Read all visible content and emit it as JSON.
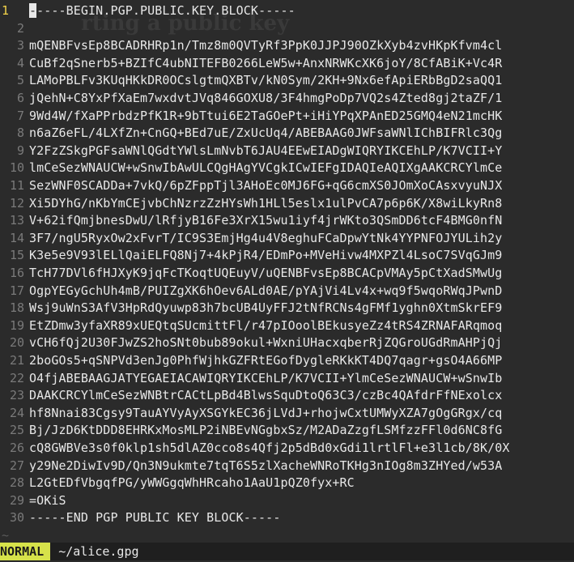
{
  "editor": {
    "lines": [
      "-----BEGIN.PGP.PUBLIC.KEY.BLOCK-----",
      "",
      "mQENBFvsEp8BCADRHRp1n/Tmz8m0QVTyRf3PpK0JJPJ90OZkXyb4zvHKpKfvm4cl",
      "CuBf2qSnerb5+BZIfC4ubNITEFB0266LeW5w+AnxNRWKcXK6joY/8CfABiK+Vc4R",
      "LAMoPBLFv3KUqHKkDR0OCslgtmQXBTv/kN0Sym/2KH+9Nx6efApiERbBgD2saQQ1",
      "jQehN+C8YxPfXaEm7wxdvtJVq846GOXU8/3F4hmgPoDp7VQ2s4Zted8gj2taZF/1",
      "9Wd4W/fXaPPrbdzPfK1R+9bTtui6E2TaGOePt+iHiYPqXPAnED25GMQ4eN21mcHK",
      "n6aZ6eFL/4LXfZn+CnGQ+BEd7uE/ZxUcUq4/ABEBAAG0JWFsaWNlIChBIFRlc3Qg",
      "Y2FzZSkgPGFsaWNlQGdtYWlsLmNvbT6JAU4EEwEIADgWIQRYIKCEhLP/K7VCII+Y",
      "lmCeSezWNAUCW+wSnwIbAwULCQgHAgYVCgkICwIEFgIDAQIeAQIXgAAKCRCYlmCe",
      "SezWNF0SCADDa+7vkQ/6pZFppTjl3AHoEc0MJ6FG+qG6cmXS0JOmXoCAsxvyuNJX",
      "Xi5DYhG/nKbYmCEjvbChNzrzZzHYsWh1HLl5eslx1ulPvCA7p6p6K/X8wiLkyRn8",
      "V+62ifQmjbnesDwU/lRfjyB16Fe3XrX15wu1iyf4jrWKto3QSmDD6tcF4BMG0nfN",
      "3F7/ngU5RyxOw2xFvrT/IC9S3EmjHg4u4V8eghuFCaDpwYtNk4YYPNFOJYULih2y",
      "K3e5e9V93lELlQaiELFQ8Nj7+4kPjR4/EDmPo+MVeHivw4MXPZl4LsoC7SVqGJm9",
      "TcH77DVl6fHJXyK9jqFcTKoqtUQEuyV/uQENBFvsEp8BCACpVMAy5pCtXadSMwUg",
      "OgpYEGyGchUh4mB/PUIZgXK6hOev6ALd0AE/pYAjVi4Lv4x+wq9f5wqoRWqJPwnD",
      "Wsj9uWnS3AfV3HpRdQyuwp83h7bcUB4UyFFJ2tNfRCNs4gFMf1yghn0XtmSkrEF9",
      "EtZDmw3yfaXR89xUEQtqSUcmittFl/r47pIOoolBEkusyeZz4tRS4ZRNAFARqmoq",
      "vCH6fQj2U30FJwZS2hoSNt0bub89okul+WxniUHacxqberRjZQGroUGdRmAHPjQj",
      "2boGOs5+qSNPVd3enJg0PhfWjhkGZFRtEGofDygleRKkKT4DQ7qagr+gsO4A66MP",
      "O4fjABEBAAGJATYEGAEIACAWIQRYIKCEhLP/K7VCII+YlmCeSezWNAUCW+wSnwIb",
      "DAAKCRCYlmCeSezWNBtrCACtLpBd4BlwsSquDtoQ63C3/czBc4QAfdrFfNExolcx",
      "hf8Nnai83Cgsy9TauAYVyAyXSGYkEC36jLVdJ+rhojwCxtUMWyXZA7gOgGRgx/cq",
      "Bj/JzD6KtDDD8EHRKxMosMLP2iNBEvNGgbxSz/M2ADaZzgfLSMfzzFFl0d6NC8fG",
      "cQ8GWBVe3s0f0klp1sh5dlAZ0cco8s4Qfj2p5dBd0xGdi1lrtlFl+e3l1cb/8K/0X",
      "y29Ne2DiwIv9D/Qn3N9ukmte7tqT6S5zlXacheWNRoTKHg3nIOg8m3ZHYed/w53A",
      "L2GtEDfVbgqfPG/yWWGgqWhHRcaho1AaU1pQZ0fyx+RC",
      "=OKiS",
      "-----END PGP PUBLIC KEY BLOCK-----"
    ],
    "tilde_rows": 1
  },
  "status": {
    "mode": "NORMAL",
    "filename": "~/alice.gpg"
  }
}
